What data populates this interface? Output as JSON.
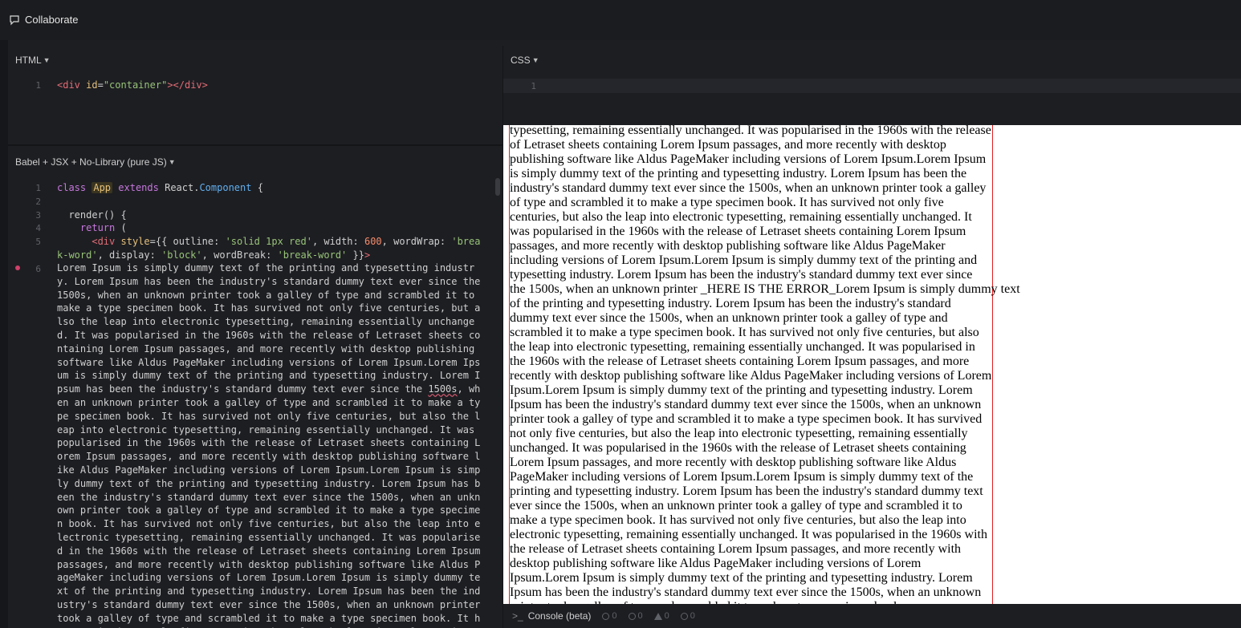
{
  "topbar": {
    "collaborate_label": "Collaborate"
  },
  "html_pane": {
    "title": "HTML",
    "lines": [
      {
        "n": "1"
      }
    ]
  },
  "css_pane": {
    "title": "CSS",
    "line_numbers": [
      "1"
    ]
  },
  "js_pane": {
    "title": "Babel + JSX + No-Library (pure JS)",
    "line_numbers": [
      "1",
      "2",
      "3",
      "4",
      "5",
      "6"
    ],
    "body_text_a": "Lorem Ipsum is simply dummy text of the printing and typesetting industry. Lorem Ipsum has been the industry's standard dummy text ever since the 1500s, when an unknown printer took a galley of type and scrambled it to make a type specimen book. It has survived not only five centuries, but also the leap into electronic typesetting, remaining essentially unchanged. It was popularised in the 1960s with the release of Letraset sheets containing Lorem Ipsum passages, and more recently with desktop publishing software like Aldus PageMaker including versions of Lorem Ipsum.Lorem Ipsum is simply dummy text of the printing and typesetting industry. Lorem Ipsum has been the industry's standard dummy text ever since the ",
    "body_error_word": "1500s",
    "body_text_b": ", when an unknown printer took a galley of type and scrambled it to make a type specimen book. It has survived not only five centuries, but also the leap into electronic typesetting, remaining essentially unchanged. It was popularised in the 1960s with the release of Letraset sheets containing Lorem Ipsum passages, and more recently with desktop publishing software like Aldus PageMaker including versions of Lorem Ipsum.Lorem Ipsum is simply dummy text of the printing and typesetting industry. Lorem Ipsum has been the industry's standard dummy text ever since the 1500s, when an unknown printer took a galley of type and scrambled it to make a type specimen book. It has survived not only five centuries, but also the leap into electronic typesetting, remaining essentially unchanged. It was popularised in the 1960s with the release of Letraset sheets containing Lorem Ipsum passages, and more recently with desktop publishing software like Aldus PageMaker including versions of Lorem Ipsum.Lorem Ipsum is simply dummy text of the printing and typesetting industry. Lorem Ipsum has been the industry's standard dummy text ever since the 1500s, when an unknown printer took a galley of type and scrambled it to make a type specimen book. It has survived not only five centuries, but also the leap into electronic typesetting, remaining essentially unchanged."
  },
  "result": {
    "paragraph_before": "typesetting, remaining essentially unchanged. It was popularised in the 1960s with the release of Letraset sheets containing Lorem Ipsum passages, and more recently with desktop publishing software like Aldus PageMaker including versions of Lorem Ipsum.Lorem Ipsum is simply dummy text of the printing and typesetting industry. Lorem Ipsum has been the industry's standard dummy text ever since the 1500s, when an unknown printer took a galley of type and scrambled it to make a type specimen book. It has survived not only five centuries, but also the leap into electronic typesetting, remaining essentially unchanged. It was popularised in the 1960s with the release of Letraset sheets containing Lorem Ipsum passages, and more recently with desktop publishing software like Aldus PageMaker including versions of Lorem Ipsum.Lorem Ipsum is simply dummy text of the printing and typesetting industry. Lorem Ipsum has been the industry's standard dummy text ever since",
    "overflow_line": "the 1500s, when an unknown printer _HERE IS THE ERROR_Lorem Ipsum is simply dummy text",
    "paragraph_after": "of the printing and typesetting industry. Lorem Ipsum has been the industry's standard dummy text ever since the 1500s, when an unknown printer took a galley of type and scrambled it to make a type specimen book. It has survived not only five centuries, but also the leap into electronic typesetting, remaining essentially unchanged. It was popularised in the 1960s with the release of Letraset sheets containing Lorem Ipsum passages, and more recently with desktop publishing software like Aldus PageMaker including versions of Lorem Ipsum.Lorem Ipsum is simply dummy text of the printing and typesetting industry. Lorem Ipsum has been the industry's standard dummy text ever since the 1500s, when an unknown printer took a galley of type and scrambled it to make a type specimen book. It has survived not only five centuries, but also the leap into electronic typesetting, remaining essentially unchanged. It was popularised in the 1960s with the release of Letraset sheets containing Lorem Ipsum passages, and more recently with desktop publishing software like Aldus PageMaker including versions of Lorem Ipsum.Lorem Ipsum is simply dummy text of the printing and typesetting industry. Lorem Ipsum has been the industry's standard dummy text ever since the 1500s, when an unknown printer took a galley of type and scrambled it to make a type specimen book. It has survived not only five centuries, but also the leap into electronic typesetting, remaining essentially unchanged. It was popularised in the 1960s with the release of Letraset sheets containing Lorem Ipsum passages, and more recently with desktop publishing software like Aldus PageMaker including versions of Lorem Ipsum.Lorem Ipsum is simply dummy text of the printing and typesetting industry. Lorem Ipsum has been the industry's standard dummy text ever since the 1500s, when an unknown printer took a galley of type and scrambled it to make a type specimen book."
  },
  "console": {
    "label": "Console (beta)",
    "counts": [
      "0",
      "0",
      "0",
      "0"
    ]
  }
}
